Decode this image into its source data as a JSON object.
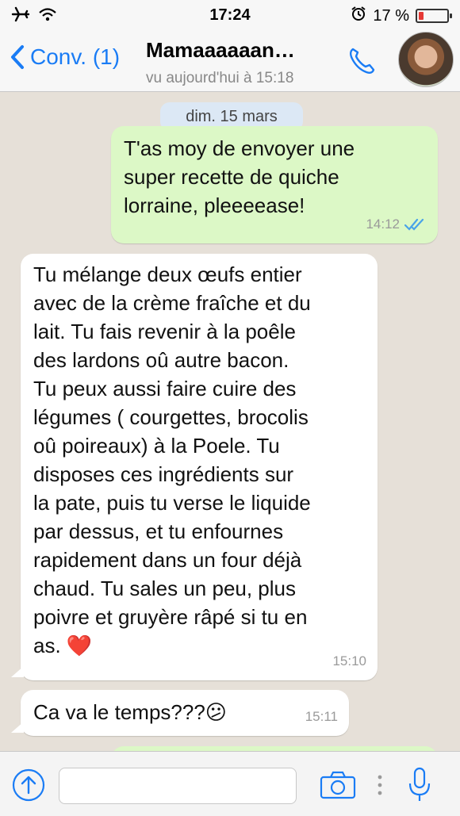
{
  "status": {
    "time": "17:24",
    "battery_pct": "17 %",
    "battery_level": 0.17,
    "icons": [
      "airplane-icon",
      "wifi-icon",
      "alarm-icon",
      "battery-icon"
    ]
  },
  "nav": {
    "back_label": "Conv. (1)",
    "contact_name": "Mamaaaaaan…",
    "last_seen": "vu aujourd'hui à 15:18",
    "accent": "#1a7cf5"
  },
  "chat": {
    "date_label": "dim. 15 mars",
    "messages": [
      {
        "direction": "out",
        "text": "T'as moy de envoyer une\nsuper recette de quiche\nlorraine, pleeeease!",
        "time": "14:12",
        "status": "read"
      },
      {
        "direction": "in",
        "text": "Tu mélange deux œufs entier\navec de la crème fraîche et du\nlait. Tu fais revenir à la poêle\ndes lardons oû autre bacon.\nTu peux aussi faire cuire des\nlégumes ( courgettes, brocolis\noû poireaux) à la Poele. Tu\ndisposes ces ingrédients sur\nla pate, puis tu verse le liquide\npar dessus, et tu enfournes\nrapidement dans un four déjà\nchaud. Tu sales un peu, plus\npoivre et gruyère râpé si tu en\nas. ❤️",
        "time": "15:10"
      },
      {
        "direction": "in",
        "text": "Ca va le temps???😕",
        "time": "15:11"
      }
    ]
  },
  "input": {
    "value": "",
    "placeholder": ""
  },
  "colors": {
    "outgoing_bubble": "#dcf8c6",
    "incoming_bubble": "#ffffff",
    "chat_background": "#e6e0d8",
    "read_ticks": "#4aa3e8"
  }
}
